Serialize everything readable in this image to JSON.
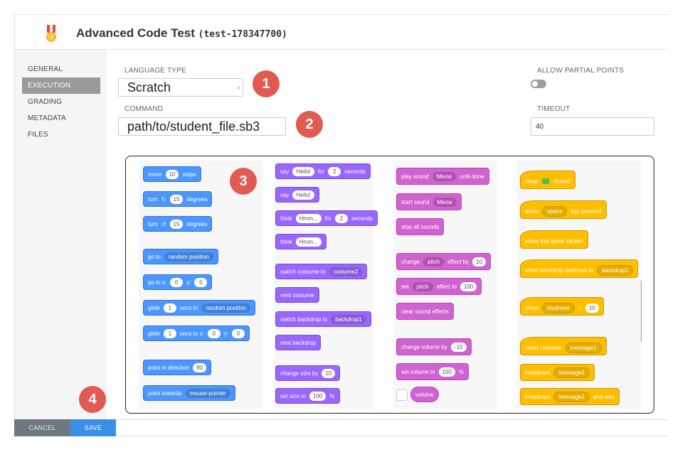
{
  "header": {
    "title": "Advanced Code Test",
    "code": "(test-178347700)",
    "medal_icon": "medal-icon"
  },
  "sidebar": {
    "items": [
      {
        "label": "GENERAL",
        "active": false
      },
      {
        "label": "EXECUTION",
        "active": true
      },
      {
        "label": "GRADING",
        "active": false
      },
      {
        "label": "METADATA",
        "active": false
      },
      {
        "label": "FILES",
        "active": false
      }
    ]
  },
  "form": {
    "language_label": "LANGUAGE TYPE",
    "language_value": "Scratch",
    "command_label": "COMMAND",
    "command_value": "path/to/student_file.sb3",
    "partial_label": "ALLOW PARTIAL POINTS",
    "timeout_label": "TIMEOUT",
    "timeout_value": "40"
  },
  "badges": [
    "1",
    "2",
    "3",
    "4"
  ],
  "blocks": {
    "motion": {
      "move": [
        "move",
        "10",
        "steps"
      ],
      "turn_right": [
        "turn",
        "15",
        "degrees"
      ],
      "turn_left": [
        "turn",
        "15",
        "degrees"
      ],
      "goto": [
        "go to",
        "random position"
      ],
      "goto_xy": [
        "go to x:",
        "0",
        "y:",
        "0"
      ],
      "glide": [
        "glide",
        "1",
        "secs to",
        "random position"
      ],
      "glide_xy": [
        "glide",
        "1",
        "secs to x:",
        "0",
        "y:",
        "0"
      ],
      "direction": [
        "point in direction",
        "90"
      ],
      "towards": [
        "point towards",
        "mouse-pointer"
      ]
    },
    "looks": {
      "say_for": [
        "say",
        "Hello!",
        "for",
        "2",
        "seconds"
      ],
      "say": [
        "say",
        "Hello!"
      ],
      "think_for": [
        "think",
        "Hmm...",
        "for",
        "2",
        "seconds"
      ],
      "think": [
        "think",
        "Hmm..."
      ],
      "switch_costume": [
        "switch costume to",
        "costume2"
      ],
      "next_costume": "next costume",
      "switch_backdrop": [
        "switch backdrop to",
        "backdrop1"
      ],
      "next_backdrop": "next backdrop",
      "change_size": [
        "change size by",
        "10"
      ],
      "set_size": [
        "set size to",
        "100",
        "%"
      ]
    },
    "sound": {
      "play_until": [
        "play sound",
        "Meow",
        "until done"
      ],
      "start": [
        "start sound",
        "Meow"
      ],
      "stop": "stop all sounds",
      "change_effect": [
        "change",
        "pitch",
        "effect by",
        "10"
      ],
      "set_effect": [
        "set",
        "pitch",
        "effect to",
        "100"
      ],
      "clear": "clear sound effects",
      "change_volume": [
        "change volume by",
        "-10"
      ],
      "set_volume": [
        "set volume to",
        "100",
        "%"
      ],
      "volume": "volume"
    },
    "events": {
      "flag": [
        "when",
        "clicked"
      ],
      "key": [
        "when",
        "space",
        "key pressed"
      ],
      "sprite": "when this sprite clicked",
      "backdrop": [
        "when backdrop switches to",
        "backdrop1"
      ],
      "loudness": [
        "when",
        "loudness",
        ">",
        "10"
      ],
      "receive": [
        "when I receive",
        "message1"
      ],
      "broadcast": [
        "broadcast",
        "message1"
      ],
      "broadcast_wait": [
        "broadcast",
        "message1",
        "and wait"
      ]
    }
  },
  "footer": {
    "cancel_label": "CANCEL",
    "save_label": "SAVE"
  },
  "colors": {
    "motion": "#4c97ff",
    "looks": "#9966ff",
    "sound": "#cf63cf",
    "events": "#ffbf00",
    "badge": "#e05b52",
    "save": "#3a8ee6"
  }
}
